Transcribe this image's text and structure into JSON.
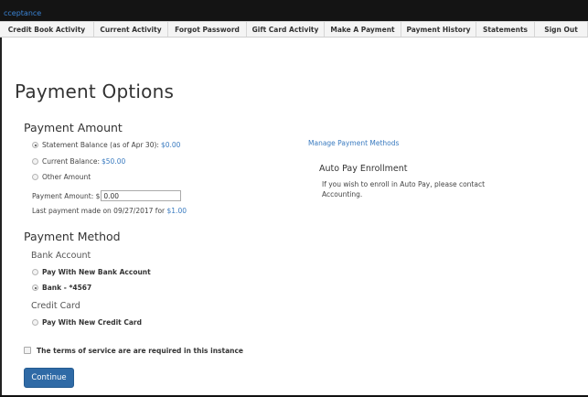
{
  "topbar": {
    "app_name": "cceptance"
  },
  "nav": {
    "items": [
      {
        "label": "Credit Book Activity"
      },
      {
        "label": "Current Activity"
      },
      {
        "label": "Forgot Password"
      },
      {
        "label": "Gift Card Activity"
      },
      {
        "label": "Make A Payment"
      },
      {
        "label": "Payment History"
      },
      {
        "label": "Statements"
      },
      {
        "label": "Sign Out"
      }
    ]
  },
  "page": {
    "title": "Payment Options"
  },
  "payment_amount": {
    "heading": "Payment Amount",
    "options": [
      {
        "label": "Statement Balance (as of Apr 30):",
        "amount": "$0.00",
        "checked": true
      },
      {
        "label": "Current Balance:",
        "amount": "$50.00",
        "checked": false
      },
      {
        "label": "Other Amount",
        "amount": "",
        "checked": false
      }
    ],
    "amount_label": "Payment Amount: $",
    "amount_value": "0.00",
    "last_payment_text": "Last payment made on 09/27/2017 for",
    "last_payment_amount": "$1.00"
  },
  "right_panel": {
    "manage_link": "Manage Payment Methods",
    "autopay_heading": "Auto Pay Enrollment",
    "autopay_message": "If you wish to enroll in Auto Pay, please contact Accounting."
  },
  "payment_method": {
    "heading": "Payment Method",
    "bank_heading": "Bank Account",
    "bank_options": [
      {
        "label": "Pay With New Bank Account",
        "checked": false
      },
      {
        "label": "Bank - *4567",
        "checked": true
      }
    ],
    "card_heading": "Credit Card",
    "card_options": [
      {
        "label": "Pay With New Credit Card",
        "checked": false
      }
    ]
  },
  "terms": {
    "label": "The terms of service are are required in this instance",
    "checked": false
  },
  "continue_button": {
    "label": "Continue"
  },
  "colors": {
    "link": "#3a7bc0",
    "button": "#2f6aa6",
    "topbar": "#141414"
  }
}
